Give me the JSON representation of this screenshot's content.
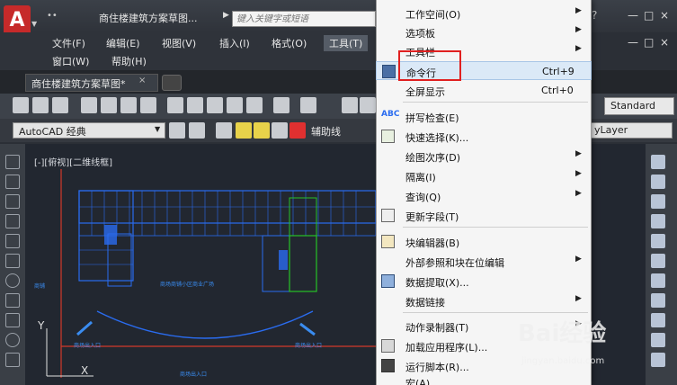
{
  "app": {
    "logo_letter": "A",
    "quick_access": "••",
    "title": "商住楼建筑方案草图...",
    "search_placeholder": "键入关键字或短语",
    "help_icon": "?",
    "window_controls": [
      "—",
      "□",
      "×"
    ],
    "doc_window_controls": [
      "—",
      "□",
      "×"
    ]
  },
  "menubar": {
    "items": [
      "文件(F)",
      "编辑(E)",
      "视图(V)",
      "插入(I)",
      "格式(O)",
      "工具(T)"
    ],
    "items_row2": [
      "窗口(W)",
      "帮助(H)"
    ],
    "active_index": 5
  },
  "tabs": {
    "doc_tab": "商住楼建筑方案草图*",
    "close": "×"
  },
  "toolbar": {
    "text_style": "Standard",
    "workspace": "AutoCAD 经典",
    "layer": "辅助线",
    "linetype": "yLayer"
  },
  "canvas": {
    "view_label": "[-][俯视][二维线框]",
    "axis_y": "Y",
    "axis_x": "X",
    "labels": {
      "center": "商场商铺小区商业广场",
      "left_side": "商铺",
      "entrance_left": "商场出入口",
      "entrance_right": "商场出入口",
      "entrance_bottom": "商场出入口"
    }
  },
  "tools_menu": {
    "items": [
      {
        "label": "工作空间(O)",
        "submenu": true
      },
      {
        "label": "选项板",
        "submenu": true
      },
      {
        "label": "工具栏",
        "submenu": true
      },
      {
        "label": "命令行",
        "shortcut": "Ctrl+9",
        "highlighted": true
      },
      {
        "label": "全屏显示",
        "shortcut": "Ctrl+0"
      },
      {
        "label": "拼写检查(E)"
      },
      {
        "label": "快速选择(K)..."
      },
      {
        "label": "绘图次序(D)",
        "submenu": true
      },
      {
        "label": "隔离(I)",
        "submenu": true
      },
      {
        "label": "查询(Q)",
        "submenu": true
      },
      {
        "label": "更新字段(T)"
      },
      {
        "label": "块编辑器(B)"
      },
      {
        "label": "外部参照和块在位编辑",
        "submenu": true
      },
      {
        "label": "数据提取(X)..."
      },
      {
        "label": "数据链接",
        "submenu": true
      },
      {
        "label": "动作录制器(T)",
        "submenu": true
      },
      {
        "label": "加载应用程序(L)..."
      },
      {
        "label": "运行脚本(R)..."
      },
      {
        "label": "宏(A)",
        "submenu": true
      }
    ]
  },
  "watermark": {
    "brand": "Bai经验",
    "url": "jingyan.baidu.com"
  },
  "colors": {
    "menu_highlight": "#dbe9f7",
    "red_annotation": "#e02020",
    "drawing_blue": "#2a6cf0",
    "drawing_green": "#27c227",
    "drawing_red": "#d23a2a",
    "logo_red": "#c62a2a"
  }
}
